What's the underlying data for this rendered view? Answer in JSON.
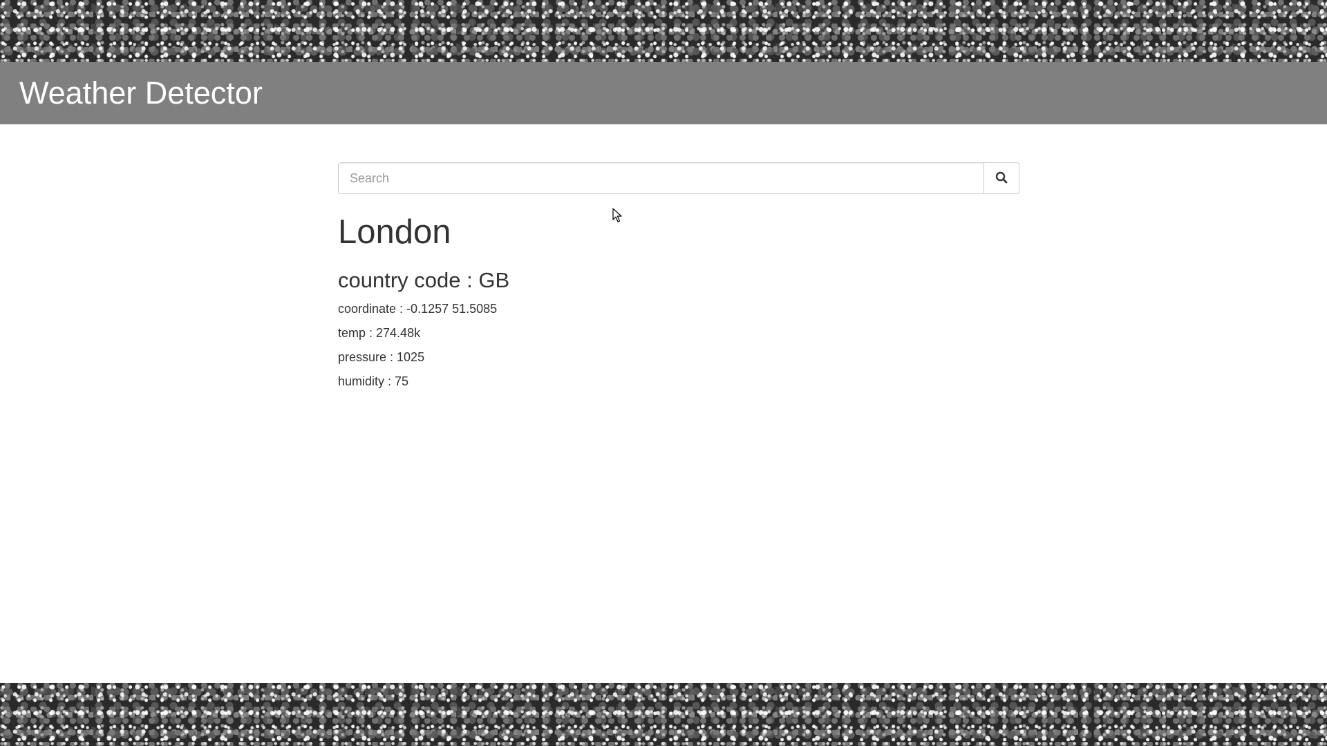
{
  "header": {
    "title": "Weather Detector"
  },
  "search": {
    "placeholder": "Search",
    "value": "",
    "button_icon": "search-icon"
  },
  "result": {
    "city": "London",
    "country_code": "country code : GB",
    "coordinate": "coordinate : -0.1257 51.5085",
    "temp": "temp : 274.48k",
    "pressure": "pressure : 1025",
    "humidity": "humidity : 75"
  },
  "colors": {
    "header_bg": "#808080",
    "header_text": "#ffffff",
    "body_text": "#333333",
    "glitter_bg": "#2a2a2a"
  }
}
